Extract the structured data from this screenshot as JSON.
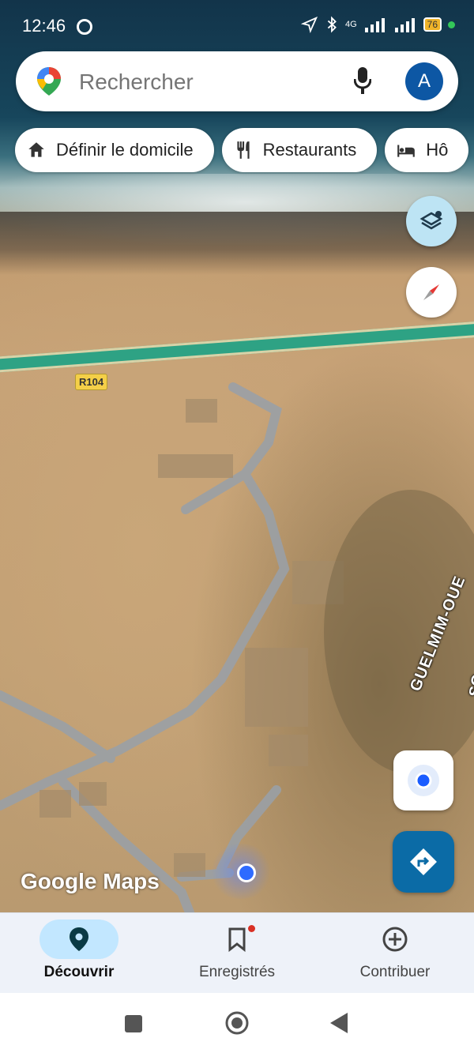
{
  "status_bar": {
    "time": "12:46",
    "network": "4G",
    "battery": "76"
  },
  "search": {
    "placeholder": "Rechercher",
    "account_initial": "A"
  },
  "chips": [
    {
      "label": "Définir le domicile",
      "icon": "home-icon"
    },
    {
      "label": "Restaurants",
      "icon": "restaurant-icon"
    },
    {
      "label": "Hô",
      "icon": "hotel-icon"
    }
  ],
  "map": {
    "road_label": "R104",
    "region_label": "GUELMIM-OUE",
    "region_label_2": "SO",
    "attribution": "Google Maps",
    "accent_road_color": "#2ea284",
    "location_color": "#2e6bff"
  },
  "bottom_nav": {
    "items": [
      {
        "label": "Découvrir",
        "icon": "pin-icon",
        "active": true
      },
      {
        "label": "Enregistrés",
        "icon": "bookmark-icon",
        "active": false
      },
      {
        "label": "Contribuer",
        "icon": "add-circle-icon",
        "active": false
      }
    ]
  }
}
